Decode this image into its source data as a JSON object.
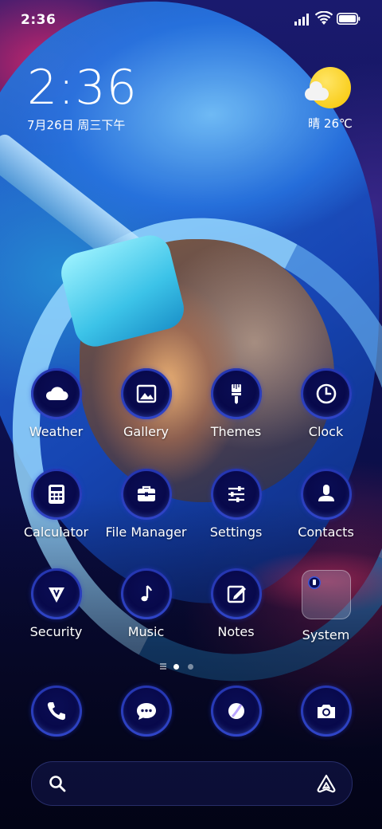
{
  "status_bar": {
    "time": "2:36",
    "icons": [
      "signal-icon",
      "wifi-icon",
      "battery-icon"
    ]
  },
  "clock_widget": {
    "time": "2:36",
    "date": "7月26日 周三下午"
  },
  "weather_widget": {
    "condition_icon": "sunny-partly-cloudy-icon",
    "text": "晴 26℃"
  },
  "apps": [
    {
      "label": "Weather",
      "icon": "cloud-icon"
    },
    {
      "label": "Gallery",
      "icon": "image-icon"
    },
    {
      "label": "Themes",
      "icon": "paintbrush-icon"
    },
    {
      "label": "Clock",
      "icon": "clock-icon"
    },
    {
      "label": "Calculator",
      "icon": "calculator-icon"
    },
    {
      "label": "File Manager",
      "icon": "briefcase-icon"
    },
    {
      "label": "Settings",
      "icon": "sliders-icon"
    },
    {
      "label": "Contacts",
      "icon": "person-icon"
    },
    {
      "label": "Security",
      "icon": "shield-icon"
    },
    {
      "label": "Music",
      "icon": "music-note-icon"
    },
    {
      "label": "Notes",
      "icon": "edit-note-icon"
    },
    {
      "label": "System",
      "icon": "folder-icon"
    }
  ],
  "page_indicator": {
    "pages": 2,
    "active_index": 0
  },
  "dock": [
    {
      "icon": "phone-icon"
    },
    {
      "icon": "message-icon"
    },
    {
      "icon": "browser-icon"
    },
    {
      "icon": "camera-icon"
    }
  ],
  "search_bar": {
    "left_icon": "search-icon",
    "right_icon": "assistant-icon"
  },
  "colors": {
    "icon_bg": "#08094a",
    "icon_ring": "#3c5aff",
    "sun": "#f7c500",
    "text": "#ffffff"
  }
}
